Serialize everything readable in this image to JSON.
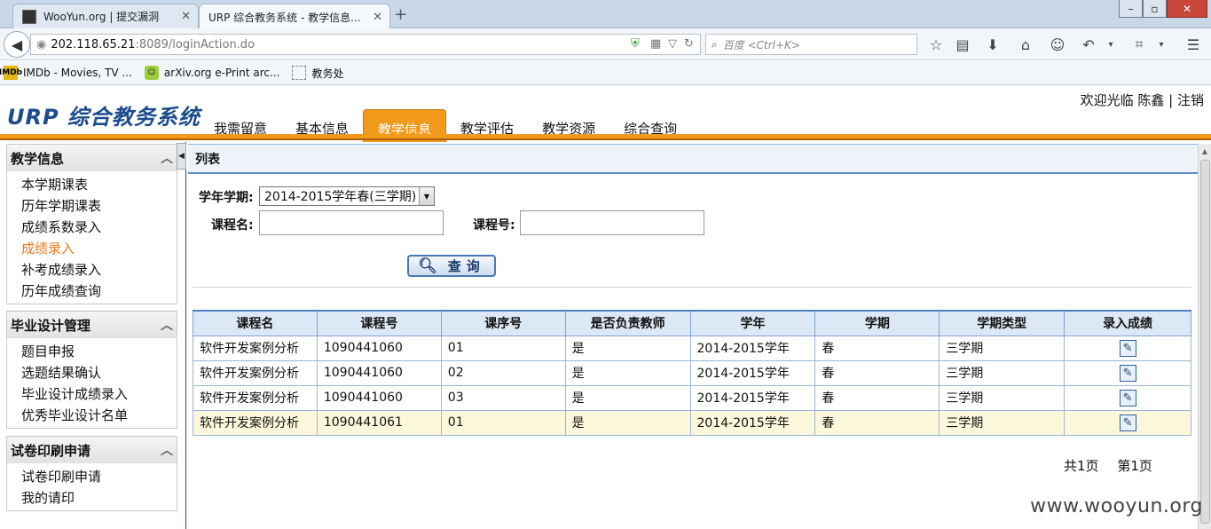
{
  "browser": {
    "tabs": [
      {
        "label": "WooYun.org | 提交漏洞",
        "active": false
      },
      {
        "label": "URP 综合教务系统 - 教学信息...",
        "active": true
      }
    ],
    "new_tab": "+",
    "window_controls": {
      "minimize": "–",
      "maximize": "▫",
      "close": "✕"
    },
    "url": {
      "host": "202.118.65.21",
      "path": ":8089/loginAction.do"
    },
    "search_placeholder": "百度 <Ctrl+K>",
    "bookmarks": [
      {
        "label": "IMDb - Movies, TV ...",
        "icon": "IMDb"
      },
      {
        "label": "arXiv.org e-Print arc...",
        "icon": "arxiv"
      },
      {
        "label": "教务处",
        "icon": "page"
      }
    ]
  },
  "header": {
    "logo": "URP 综合教务系统",
    "welcome": "欢迎光临 陈鑫 | 注销",
    "nav": [
      {
        "label": "我需留意",
        "active": false
      },
      {
        "label": "基本信息",
        "active": false
      },
      {
        "label": "教学信息",
        "active": true
      },
      {
        "label": "教学评估",
        "active": false
      },
      {
        "label": "教学资源",
        "active": false
      },
      {
        "label": "综合查询",
        "active": false
      }
    ]
  },
  "sidebar": {
    "sections": [
      {
        "title": "教学信息",
        "items": [
          {
            "label": "本学期课表",
            "active": false
          },
          {
            "label": "历年学期课表",
            "active": false
          },
          {
            "label": "成绩系数录入",
            "active": false
          },
          {
            "label": "成绩录入",
            "active": true
          },
          {
            "label": "补考成绩录入",
            "active": false
          },
          {
            "label": "历年成绩查询",
            "active": false
          }
        ]
      },
      {
        "title": "毕业设计管理",
        "items": [
          {
            "label": "题目申报",
            "active": false
          },
          {
            "label": "选题结果确认",
            "active": false
          },
          {
            "label": "毕业设计成绩录入",
            "active": false
          },
          {
            "label": "优秀毕业设计名单",
            "active": false
          }
        ]
      },
      {
        "title": "试卷印刷申请",
        "items": [
          {
            "label": "试卷印刷申请",
            "active": false
          },
          {
            "label": "我的请印",
            "active": false
          }
        ]
      }
    ]
  },
  "main": {
    "list_title": "列表",
    "form": {
      "term_label": "学年学期:",
      "term_value": "2014-2015学年春(三学期)",
      "course_name_label": "课程名:",
      "course_name_value": "",
      "course_no_label": "课程号:",
      "course_no_value": "",
      "query_button": "查询"
    },
    "table": {
      "headers": [
        "课程名",
        "课程号",
        "课序号",
        "是否负责教师",
        "学年",
        "学期",
        "学期类型",
        "录入成绩"
      ],
      "rows": [
        [
          "软件开发案例分析",
          "1090441060",
          "01",
          "是",
          "2014-2015学年",
          "春",
          "三学期"
        ],
        [
          "软件开发案例分析",
          "1090441060",
          "02",
          "是",
          "2014-2015学年",
          "春",
          "三学期"
        ],
        [
          "软件开发案例分析",
          "1090441060",
          "03",
          "是",
          "2014-2015学年",
          "春",
          "三学期"
        ],
        [
          "软件开发案例分析",
          "1090441061",
          "01",
          "是",
          "2014-2015学年",
          "春",
          "三学期"
        ]
      ],
      "highlighted_row": 3,
      "edit_icon": "edit-icon"
    },
    "pager": {
      "total": "共1页",
      "current": "第1页"
    }
  },
  "watermark": "www.wooyun.org",
  "colors": {
    "accent_orange": "#f19a1c",
    "brand_blue": "#1c4c8c",
    "active_link": "#e57a1a"
  }
}
